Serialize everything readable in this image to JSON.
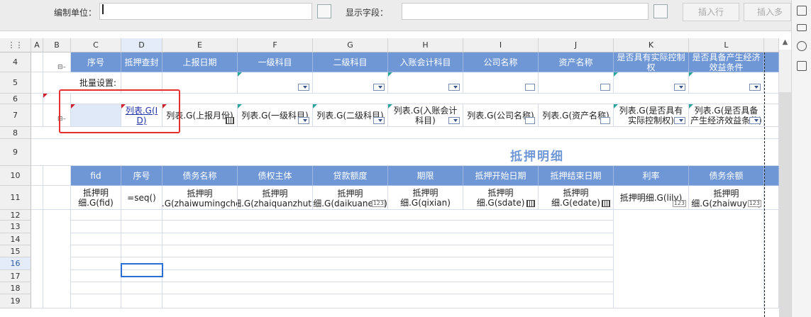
{
  "toolbar": {
    "unit_label": "编制单位：",
    "field_label": "显示字段：",
    "insert_row": "插入行",
    "insert_multi": "插入多行"
  },
  "columns": [
    "A",
    "B",
    "C",
    "D",
    "E",
    "F",
    "G",
    "H",
    "I",
    "J",
    "K",
    "L"
  ],
  "rows": [
    "4",
    "5",
    "6",
    "7",
    "8",
    "9",
    "10",
    "11",
    "12",
    "13",
    "14",
    "15",
    "16",
    "17",
    "18",
    "19"
  ],
  "row4": [
    "序号",
    "抵押查封",
    "上报日期",
    "一级科目",
    "二级科目",
    "入账会计科目",
    "公司名称",
    "资产名称",
    "是否具有实际控制权",
    "是否具备产生经济效益条件"
  ],
  "row5_label": "批量设置:",
  "row7": [
    "",
    "列表.G(ID)",
    "列表.G(上报月份)",
    "列表.G(一级科目)",
    "列表.G(二级科目)",
    "列表.G(入账会计科目)",
    "列表.G(公司名称)",
    "列表.G(资产名称)",
    "列表.G(是否具有实际控制权)",
    "列表.G(是否具备产生经济效益条件)"
  ],
  "section_title": "抵押明细",
  "row10": [
    "fid",
    "序号",
    "债务名称",
    "债权主体",
    "贷款额度",
    "期限",
    "抵押开始日期",
    "抵押结束日期",
    "利率",
    "债务余额"
  ],
  "row11": [
    "抵押明细.G(fid)",
    "=seq()",
    "抵押明细.G(zhaiwumingchen",
    "抵押明细.G(zhaiquanzhuti)",
    "抵押明细.G(daikuanedu)",
    "抵押明细.G(qixian)",
    "抵押明细.G(sdate)",
    "抵押明细.G(edate)",
    "抵押明细.G(lilv)",
    "抵押明细.G(zhaiwuyue)"
  ],
  "num_tag": "123",
  "collapse_glyph": "⊟–"
}
